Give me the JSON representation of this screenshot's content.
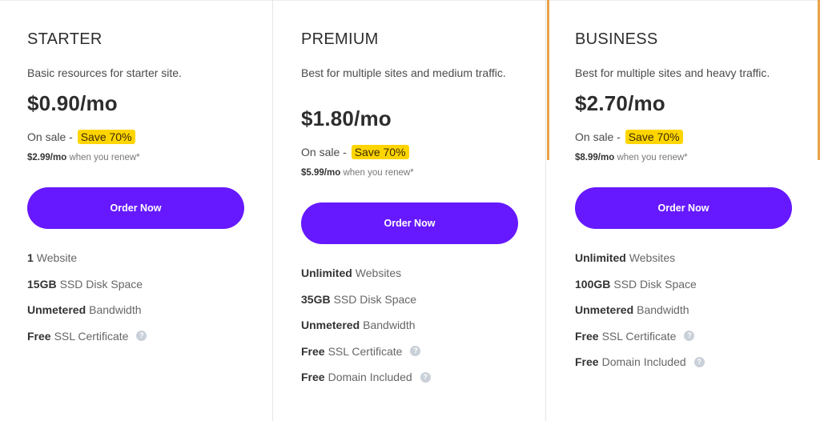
{
  "colors": {
    "accent": "#6619ff",
    "badge": "#ffd500",
    "highlight_border": "#e9a24a"
  },
  "plans": [
    {
      "name": "STARTER",
      "description": "Basic resources for starter site.",
      "price": "$0.90/mo",
      "sale_label": "On sale -",
      "save_badge": "Save 70%",
      "renew_price": "$2.99/mo",
      "renew_text": "when you renew*",
      "button": "Order Now",
      "features": [
        {
          "bold": "1",
          "text": "Website",
          "help": false
        },
        {
          "bold": "15GB",
          "text": "SSD Disk Space",
          "help": false
        },
        {
          "bold": "Unmetered",
          "text": "Bandwidth",
          "help": false
        },
        {
          "bold": "Free",
          "text": "SSL Certificate",
          "help": true
        }
      ]
    },
    {
      "name": "PREMIUM",
      "description": "Best for multiple sites and medium traffic.",
      "price": "$1.80/mo",
      "sale_label": "On sale -",
      "save_badge": "Save 70%",
      "renew_price": "$5.99/mo",
      "renew_text": "when you renew*",
      "button": "Order Now",
      "features": [
        {
          "bold": "Unlimited",
          "text": "Websites",
          "help": false
        },
        {
          "bold": "35GB",
          "text": "SSD Disk Space",
          "help": false
        },
        {
          "bold": "Unmetered",
          "text": "Bandwidth",
          "help": false
        },
        {
          "bold": "Free",
          "text": "SSL Certificate",
          "help": true
        },
        {
          "bold": "Free",
          "text": "Domain Included",
          "help": true
        }
      ]
    },
    {
      "name": "BUSINESS",
      "description": "Best for multiple sites and heavy traffic.",
      "price": "$2.70/mo",
      "sale_label": "On sale -",
      "save_badge": "Save 70%",
      "renew_price": "$8.99/mo",
      "renew_text": "when you renew*",
      "button": "Order Now",
      "features": [
        {
          "bold": "Unlimited",
          "text": "Websites",
          "help": false
        },
        {
          "bold": "100GB",
          "text": "SSD Disk Space",
          "help": false
        },
        {
          "bold": "Unmetered",
          "text": "Bandwidth",
          "help": false
        },
        {
          "bold": "Free",
          "text": "SSL Certificate",
          "help": true
        },
        {
          "bold": "Free",
          "text": "Domain Included",
          "help": true
        }
      ]
    }
  ]
}
